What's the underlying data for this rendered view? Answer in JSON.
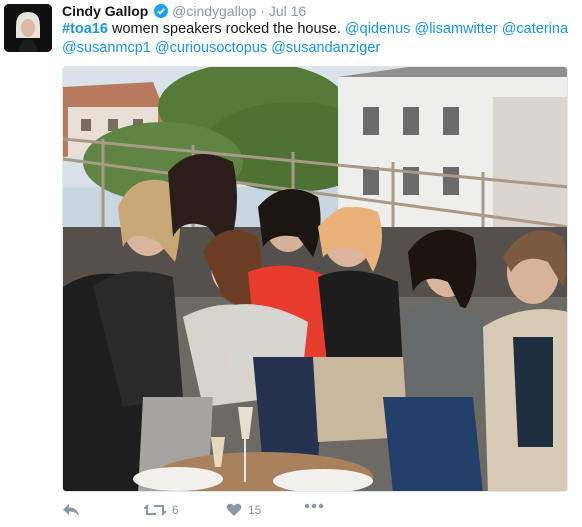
{
  "tweet": {
    "author_name": "Cindy Gallop",
    "verified_icon": "verified-badge-icon",
    "handle": "@cindygallop",
    "separator": "·",
    "timestamp": "Jul 16",
    "hashtag": "#toa16",
    "text": " women speakers rocked the house. ",
    "mentions": [
      "@qidenus",
      "@lisamwitter",
      "@caterina",
      "@susanmcp1",
      "@curiousoctopus",
      "@susandanziger"
    ]
  },
  "actions": {
    "reply_icon": "reply-icon",
    "retweet_icon": "retweet-icon",
    "retweet_count": "6",
    "like_icon": "heart-icon",
    "like_count": "15",
    "more_icon": "more-dots-icon"
  },
  "colors": {
    "link": "#1b95e0",
    "muted": "#8899a6",
    "text": "#14171a"
  }
}
